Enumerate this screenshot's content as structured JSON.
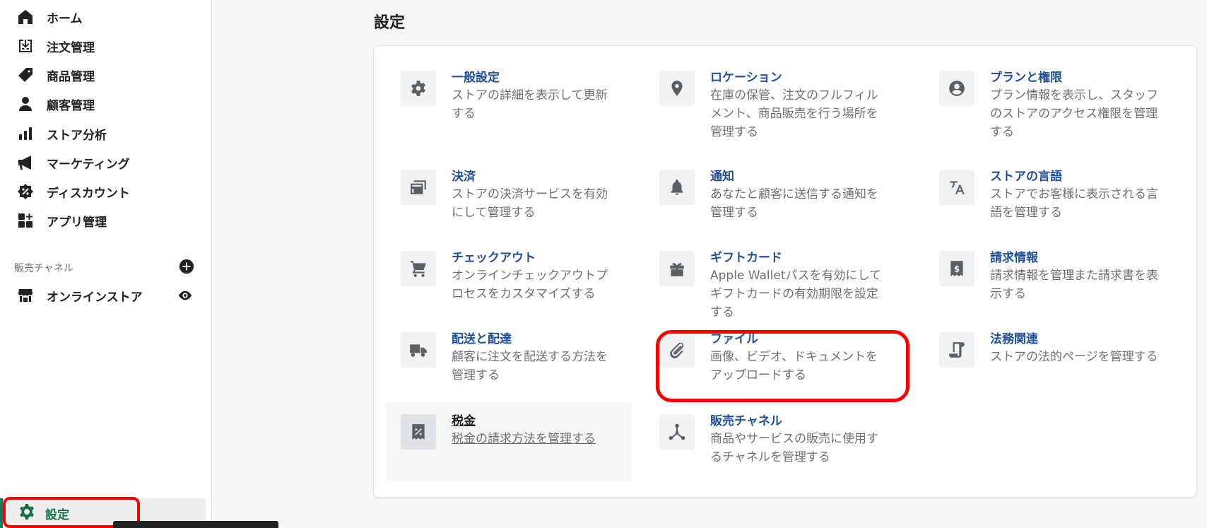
{
  "sidebar": {
    "items": [
      {
        "label": "ホーム",
        "icon": "home-icon"
      },
      {
        "label": "注文管理",
        "icon": "orders-icon"
      },
      {
        "label": "商品管理",
        "icon": "tag-icon"
      },
      {
        "label": "顧客管理",
        "icon": "customer-icon"
      },
      {
        "label": "ストア分析",
        "icon": "analytics-icon"
      },
      {
        "label": "マーケティング",
        "icon": "megaphone-icon"
      },
      {
        "label": "ディスカウント",
        "icon": "discount-icon"
      },
      {
        "label": "アプリ管理",
        "icon": "apps-icon"
      }
    ],
    "channels_heading": "販売チャネル",
    "online_store": "オンラインストア",
    "settings": "設定"
  },
  "main": {
    "title": "設定",
    "tiles": [
      {
        "title": "一般設定",
        "desc": "ストアの詳細を表示して更新する",
        "icon": "gear-icon"
      },
      {
        "title": "ロケーション",
        "desc": "在庫の保管、注文のフルフィルメント、商品販売を行う場所を管理する",
        "icon": "location-pin-icon"
      },
      {
        "title": "プランと権限",
        "desc": "プラン情報を表示し、スタッフのストアのアクセス権限を管理する",
        "icon": "user-circle-icon"
      },
      {
        "title": "決済",
        "desc": "ストアの決済サービスを有効にして管理する",
        "icon": "credit-card-icon"
      },
      {
        "title": "通知",
        "desc": "あなたと顧客に送信する通知を管理する",
        "icon": "bell-icon"
      },
      {
        "title": "ストアの言語",
        "desc": "ストアでお客様に表示される言語を管理する",
        "icon": "translate-icon"
      },
      {
        "title": "チェックアウト",
        "desc": "オンラインチェックアウトプロセスをカスタマイズする",
        "icon": "cart-icon"
      },
      {
        "title": "ギフトカード",
        "desc": "Apple Walletパスを有効にしてギフトカードの有効期限を設定する",
        "icon": "gift-icon"
      },
      {
        "title": "請求情報",
        "desc": "請求情報を管理また請求書を表示する",
        "icon": "billing-icon"
      },
      {
        "title": "配送と配達",
        "desc": "顧客に注文を配送する方法を管理する",
        "icon": "truck-icon"
      },
      {
        "title": "ファイル",
        "desc": "画像、ビデオ、ドキュメントをアップロードする",
        "icon": "paperclip-icon"
      },
      {
        "title": "法務関連",
        "desc": "ストアの法的ページを管理する",
        "icon": "legal-icon"
      },
      {
        "title": "税金",
        "desc": "税金の請求方法を管理する",
        "icon": "tax-icon"
      },
      {
        "title": "販売チャネル",
        "desc": "商品やサービスの販売に使用するチャネルを管理する",
        "icon": "channels-icon"
      }
    ]
  },
  "colors": {
    "link": "#1f5199",
    "accent": "#008060",
    "highlight": "#ff0000"
  }
}
